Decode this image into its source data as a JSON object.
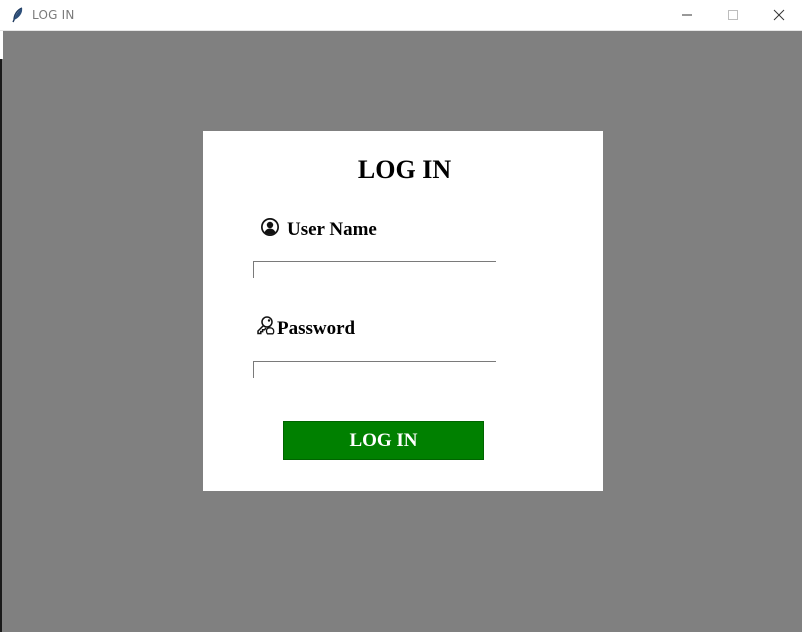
{
  "window": {
    "title": "LOG IN",
    "app_icon": "feather-icon",
    "controls": {
      "minimize_icon": "minimize-icon",
      "maximize_icon": "maximize-icon",
      "close_icon": "close-icon"
    }
  },
  "form": {
    "heading": "LOG IN",
    "username": {
      "icon": "user-icon",
      "label": "User Name",
      "value": ""
    },
    "password": {
      "icon": "key-icon",
      "label": "Password",
      "value": ""
    },
    "submit_label": "LOG IN"
  },
  "colors": {
    "background": "#808080",
    "card": "#ffffff",
    "button": "#008000",
    "button_text": "#ffffff"
  }
}
